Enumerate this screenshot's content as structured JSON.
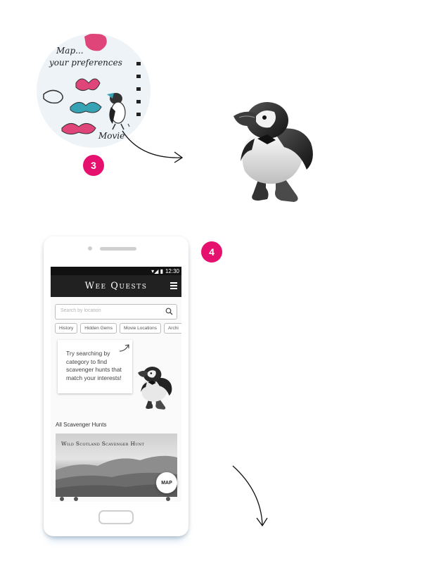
{
  "sketch": {
    "lines": [
      "Map...",
      "your preferences"
    ],
    "movie": "Movie",
    "step_badge": "3"
  },
  "phone": {
    "step_badge": "4",
    "status_time": "12:30",
    "app_title": "Wee Quests",
    "search": {
      "placeholder": "Search by location"
    },
    "chips": [
      "History",
      "Hidden Gems",
      "Movie Locations",
      "Archi"
    ],
    "tip_text": "Try searching by category to find scavenger hunts that match your interests!",
    "section_title": "All Scavenger Hunts",
    "card_title": "Wild Scotland Scavenger Hunt",
    "map_button": "MAP"
  },
  "colors": {
    "accent": "#e6106e",
    "appbar": "#212121",
    "background": "#ffffff"
  },
  "icons": [
    "search-icon",
    "menu-icon",
    "puffin-illustration",
    "arrow-icon"
  ]
}
